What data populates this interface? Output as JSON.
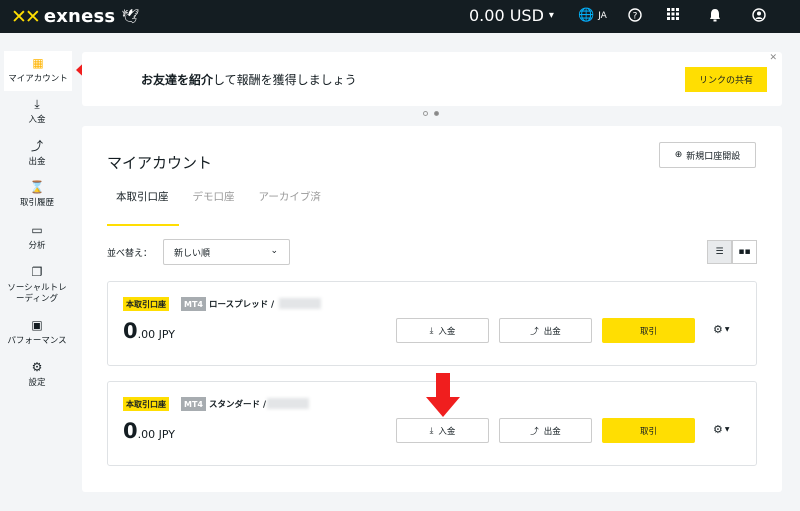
{
  "header": {
    "logo_text": "exness",
    "balance": "0.00 USD",
    "language": "JA"
  },
  "sidebar": {
    "items": [
      {
        "label": "マイアカウント",
        "icon": "grid-icon"
      },
      {
        "label": "入金",
        "icon": "download-icon"
      },
      {
        "label": "出金",
        "icon": "upload-icon"
      },
      {
        "label": "取引履歴",
        "icon": "hourglass-icon"
      },
      {
        "label": "分析",
        "icon": "analytics-icon"
      },
      {
        "label": "ソーシャルトレーディング",
        "icon": "social-trading-icon"
      },
      {
        "label": "パフォーマンス",
        "icon": "performance-icon"
      },
      {
        "label": "設定",
        "icon": "gear-icon"
      }
    ]
  },
  "banner": {
    "text_bold": "お友達を紹介",
    "text_rest": "して報酬を獲得しましょう",
    "button": "リンクの共有"
  },
  "main": {
    "title": "マイアカウント",
    "new_account_button": "新規口座開設",
    "tabs": [
      "本取引口座",
      "デモ口座",
      "アーカイブ済"
    ],
    "sort_label": "並べ替え：",
    "sort_value": "新しい順"
  },
  "accounts": [
    {
      "type_badge": "本取引口座",
      "platform": "MT4",
      "name": "ロースプレッド /",
      "amount_int": "0",
      "amount_dec": ".00 JPY",
      "deposit": "入金",
      "withdraw": "出金",
      "trade": "取引"
    },
    {
      "type_badge": "本取引口座",
      "platform": "MT4",
      "name": "スタンダード /",
      "amount_int": "0",
      "amount_dec": ".00 JPY",
      "deposit": "入金",
      "withdraw": "出金",
      "trade": "取引"
    }
  ],
  "colors": {
    "brand_yellow": "#ffde02",
    "topbar": "#141d22",
    "annotation_red": "#f01e1e"
  }
}
